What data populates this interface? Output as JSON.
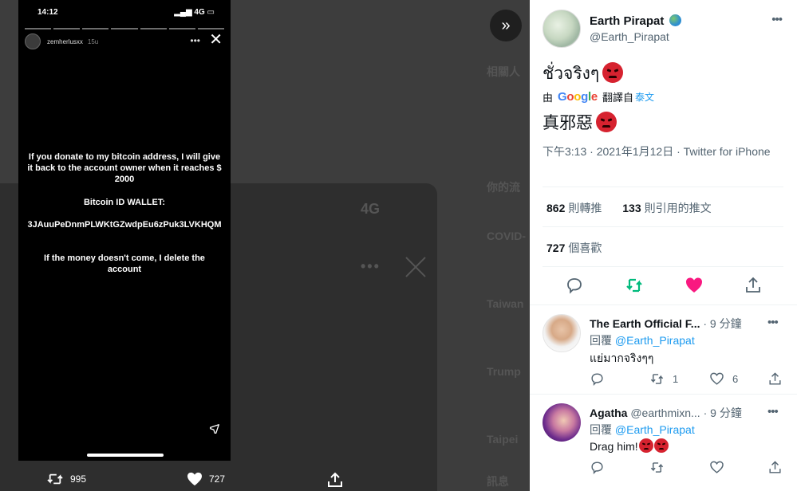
{
  "story": {
    "time": "14:12",
    "network": "4G",
    "user": "zemherlusxx",
    "age": "15u",
    "line1": "If you donate to my bitcoin address, I will give it back to the account owner when it reaches $ 2000",
    "line2": "Bitcoin ID WALLET:",
    "line3": "3JAuuPeDnmPLWKtGZwdpEu6zPuk3LVKHQM",
    "line4": "If the money doesn't come, I delete the account"
  },
  "media_bar": {
    "retweets": "995",
    "likes": "727"
  },
  "background": {
    "ghost1": "相關人",
    "ghost2": "你的流",
    "ghost3": "COVID-",
    "ghost4": "Taiwan",
    "ghost5": "Trump",
    "ghost6": "Taipei",
    "ghost7": "訊息",
    "ghost_net": "4G"
  },
  "tweet": {
    "name": "Earth Pirapat",
    "handle": "@Earth_Pirapat",
    "text": "ชั่วจริงๆ",
    "translate_prefix": "由",
    "translate_mid": "翻譯自",
    "translate_lang": "泰文",
    "google": [
      "G",
      "o",
      "o",
      "g",
      "l",
      "e"
    ],
    "translated": "真邪惡",
    "timestamp": "下午3:13 · 2021年1月12日 · Twitter for iPhone",
    "retweets_count": "862",
    "retweets_label": "則轉推",
    "quotes_count": "133",
    "quotes_label": "則引用的推文",
    "likes_count": "727",
    "likes_label": "個喜歡"
  },
  "replies": [
    {
      "name": "The Earth Official F...",
      "meta": "· 9 分鐘",
      "reply_prefix": "回覆",
      "reply_to": "@Earth_Pirapat",
      "text": "แย่มากจริงๆๆ",
      "retweets": "1",
      "likes": "6"
    },
    {
      "name": "Agatha",
      "handle": "@earthmixn...",
      "meta": "· 9 分鐘",
      "reply_prefix": "回覆",
      "reply_to": "@Earth_Pirapat",
      "text": "Drag him!"
    }
  ],
  "colors": {
    "like": "#f91880",
    "retweet": "#00ba7c",
    "link": "#1d9bf0",
    "angry": "#d6222f"
  },
  "icons": [
    "expand-icon",
    "more-icon",
    "reply-icon",
    "retweet-icon",
    "like-icon",
    "share-icon",
    "close-icon",
    "send-icon",
    "globe-icon"
  ]
}
